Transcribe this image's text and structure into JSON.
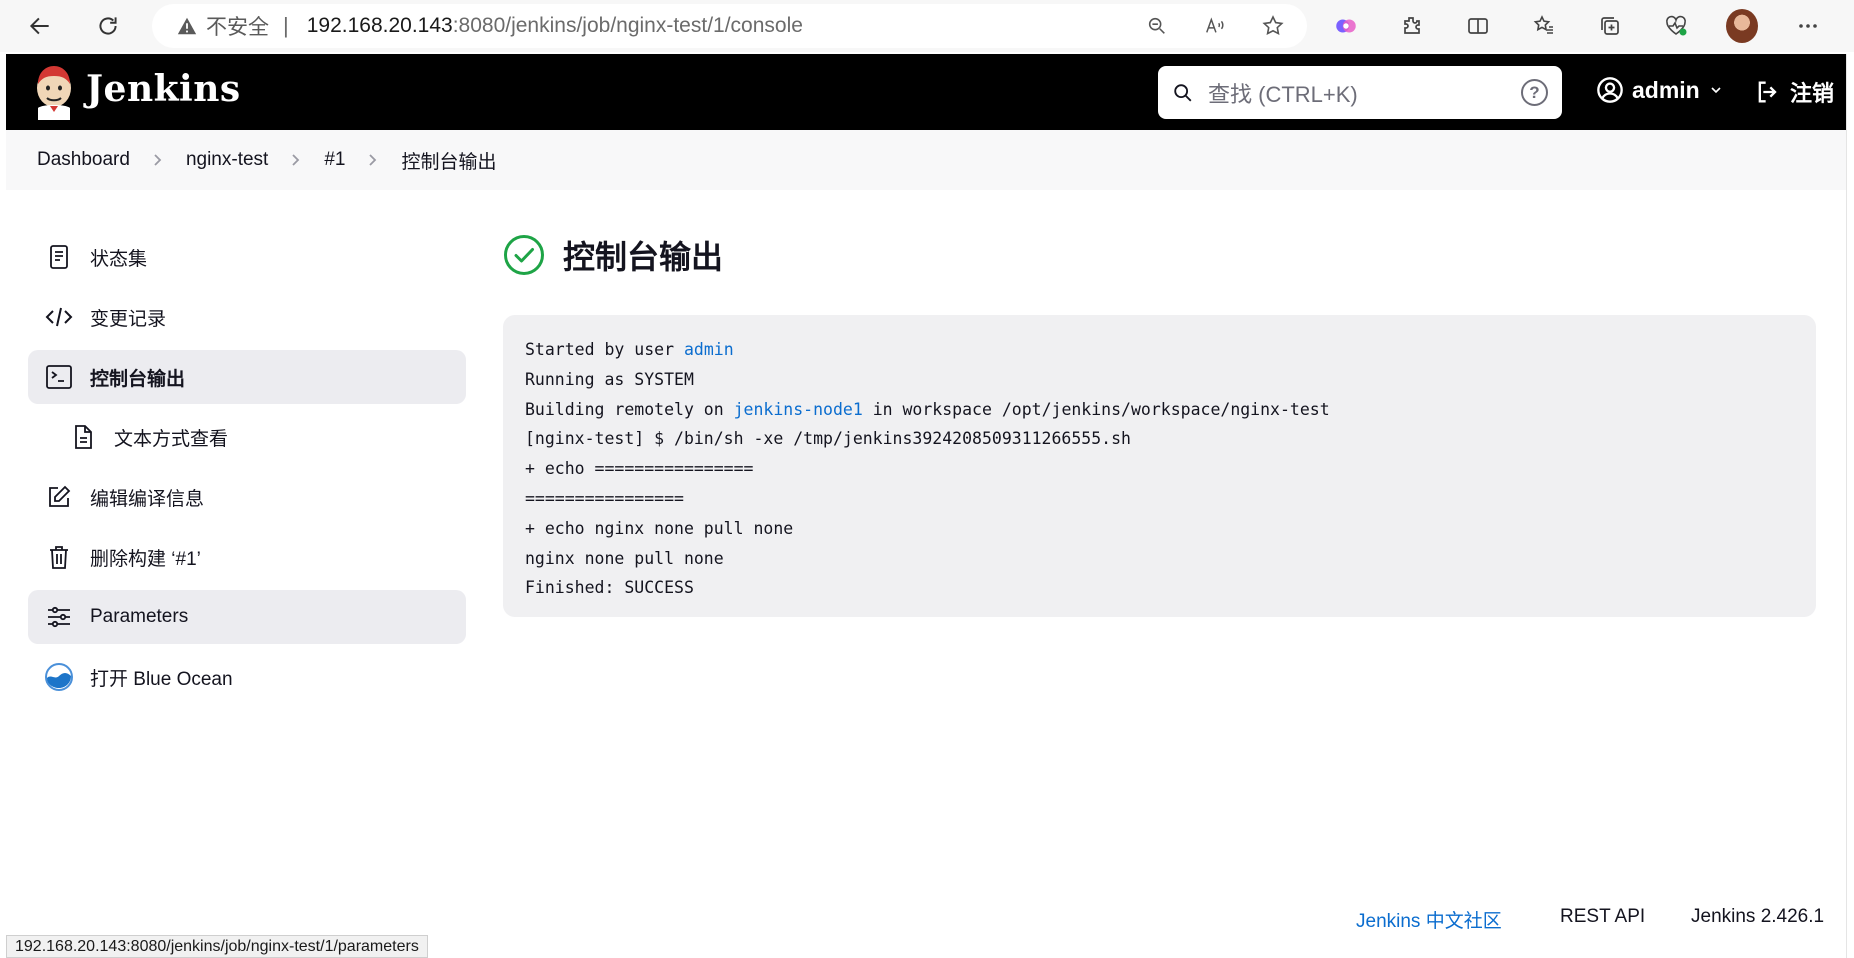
{
  "browser": {
    "security_label": "不安全",
    "url_host": "192.168.20.143",
    "url_path": ":8080/jenkins/job/nginx-test/1/console",
    "status_url": "192.168.20.143:8080/jenkins/job/nginx-test/1/parameters"
  },
  "header": {
    "brand": "Jenkins",
    "search_placeholder": "查找 (CTRL+K)",
    "help": "?",
    "user": "admin",
    "logout": "注销"
  },
  "breadcrumb": [
    "Dashboard",
    "nginx-test",
    "#1",
    "控制台输出"
  ],
  "sidebar": {
    "items": [
      {
        "label": "状态集",
        "icon": "document-icon"
      },
      {
        "label": "变更记录",
        "icon": "code-icon"
      },
      {
        "label": "控制台输出",
        "icon": "terminal-icon"
      },
      {
        "label": "文本方式查看",
        "icon": "file-text-icon"
      },
      {
        "label": "编辑编译信息",
        "icon": "edit-icon"
      },
      {
        "label": "删除构建 ‘#1’",
        "icon": "trash-icon"
      },
      {
        "label": "Parameters",
        "icon": "sliders-icon"
      },
      {
        "label": "打开 Blue Ocean",
        "icon": "blue-ocean-icon"
      }
    ]
  },
  "main": {
    "title": "控制台输出",
    "console": {
      "l1_prefix": "Started by user ",
      "l1_link": "admin",
      "l2": "Running as SYSTEM",
      "l3_prefix": "Building remotely on ",
      "l3_link": "jenkins-node1",
      "l3_suffix": " in workspace /opt/jenkins/workspace/nginx-test",
      "l4": "[nginx-test] $ /bin/sh -xe /tmp/jenkins3924208509311266555.sh",
      "l5": "+ echo ================",
      "l6": "================",
      "l7": "+ echo nginx none pull none",
      "l8": "nginx none pull none",
      "l9": "Finished: SUCCESS"
    }
  },
  "footer": {
    "community": "Jenkins 中文社区",
    "rest_api": "REST API",
    "version": "Jenkins 2.426.1"
  },
  "colors": {
    "header_bg": "#000000",
    "link": "#0b6dcf",
    "success": "#1ea446",
    "console_bg": "#f0f0f2"
  }
}
